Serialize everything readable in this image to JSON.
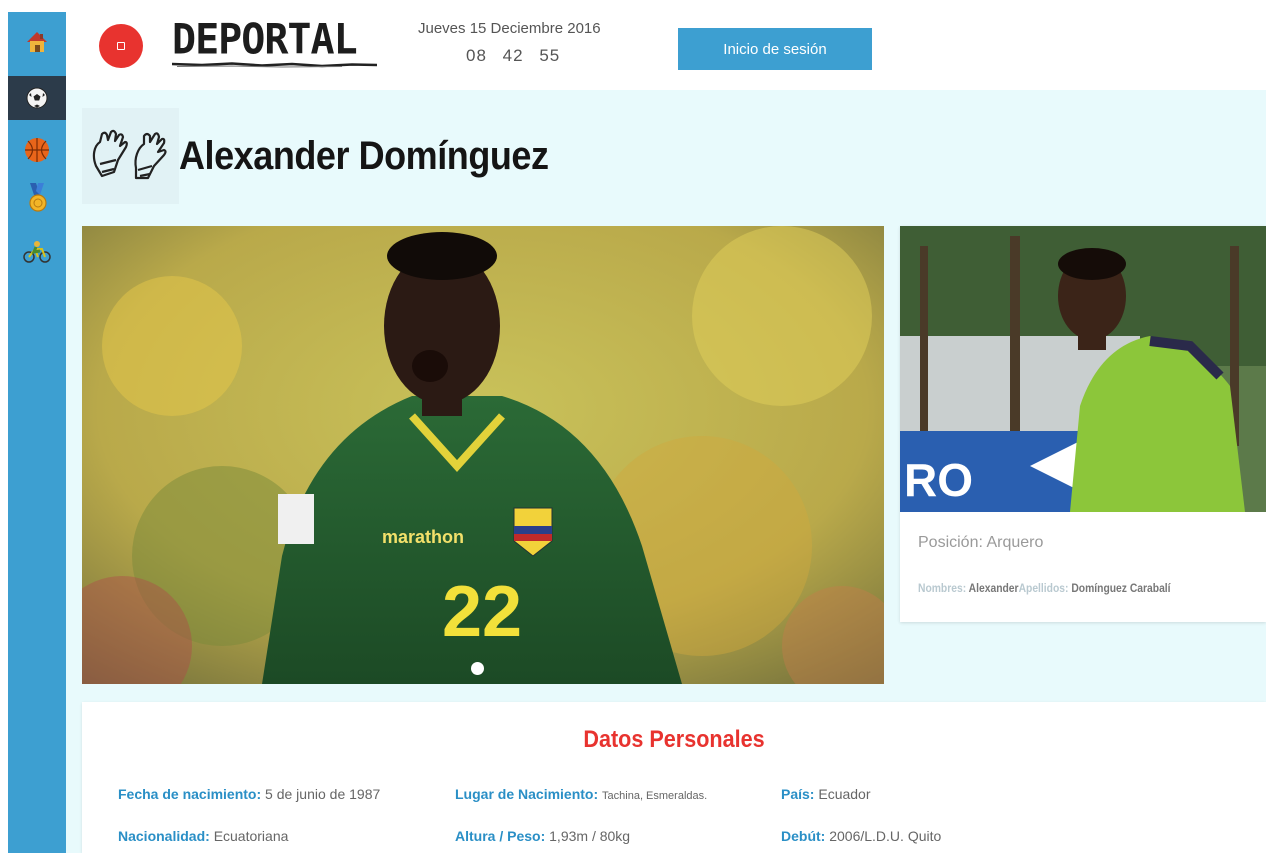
{
  "header": {
    "logo_text": "DEPORTAL",
    "date": "Jueves 15 Deciembre 2016",
    "clock": {
      "hours": "08",
      "minutes": "42",
      "seconds": "55"
    },
    "login_label": "Inicio de sesión"
  },
  "sidebar": {
    "items": [
      {
        "icon": "house-icon",
        "active": false
      },
      {
        "icon": "soccer-ball-icon",
        "active": true
      },
      {
        "icon": "basketball-icon",
        "active": false
      },
      {
        "icon": "medal-icon",
        "active": false
      },
      {
        "icon": "cyclist-icon",
        "active": false
      }
    ]
  },
  "player": {
    "name": "Alexander Domínguez",
    "icon": "goalkeeper-gloves-icon",
    "position_label": "Posición:",
    "position_value": "Arquero",
    "nombres_label": "Nombres:",
    "nombres_value": "Alexander",
    "apellidos_label": "Apellidos:",
    "apellidos_value": "Domínguez Carabalí"
  },
  "carousel": {
    "slides": 2,
    "active_index": 1
  },
  "datos": {
    "title": "Datos Personales",
    "fields": [
      {
        "label": "Fecha de nacimiento:",
        "value": "5 de junio de 1987"
      },
      {
        "label": "Lugar de Nacimiento:",
        "value": "Tachina, Esmeraldas."
      },
      {
        "label": "País:",
        "value": "Ecuador"
      },
      {
        "label": "Nacionalidad:",
        "value": "Ecuatoriana"
      },
      {
        "label": "Altura / Peso:",
        "value": "1,93m / 80kg"
      },
      {
        "label": "Debút:",
        "value": "2006/L.D.U. Quito"
      }
    ]
  },
  "colors": {
    "sidebar": "#3d9fd1",
    "sidebar_active": "#2c3b4a",
    "accent_red": "#e8332f",
    "content_bg": "#e8fafc",
    "label_blue": "#2a8fc6"
  }
}
